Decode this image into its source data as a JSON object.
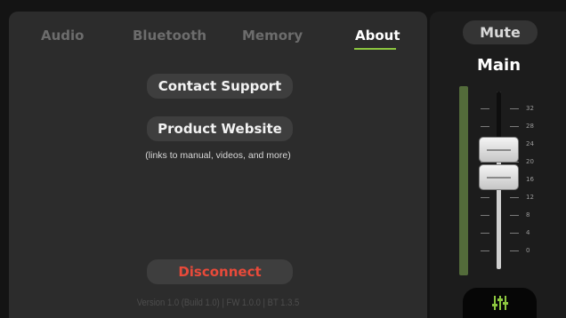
{
  "tabs": [
    {
      "label": "Audio",
      "active": false
    },
    {
      "label": "Bluetooth",
      "active": false
    },
    {
      "label": "Memory",
      "active": false
    },
    {
      "label": "About",
      "active": true
    }
  ],
  "about": {
    "contact_support": "Contact Support",
    "product_website": "Product Website",
    "links_note": "(links to manual, videos, and more)",
    "disconnect": "Disconnect",
    "version_info": "Version 1.0 (Build 1.0)  |  FW 1.0.0  |  BT 1.3.5"
  },
  "channel": {
    "mute_label": "Mute",
    "name": "Main",
    "fader_scale": [
      "32",
      "28",
      "24",
      "20",
      "16",
      "12",
      "8",
      "4",
      "0"
    ],
    "mixer_icon": "sliders-icon"
  },
  "colors": {
    "accent": "#8cc63f",
    "disconnect": "#e84a3a",
    "panel": "#2c2c2c",
    "background": "#141414"
  }
}
